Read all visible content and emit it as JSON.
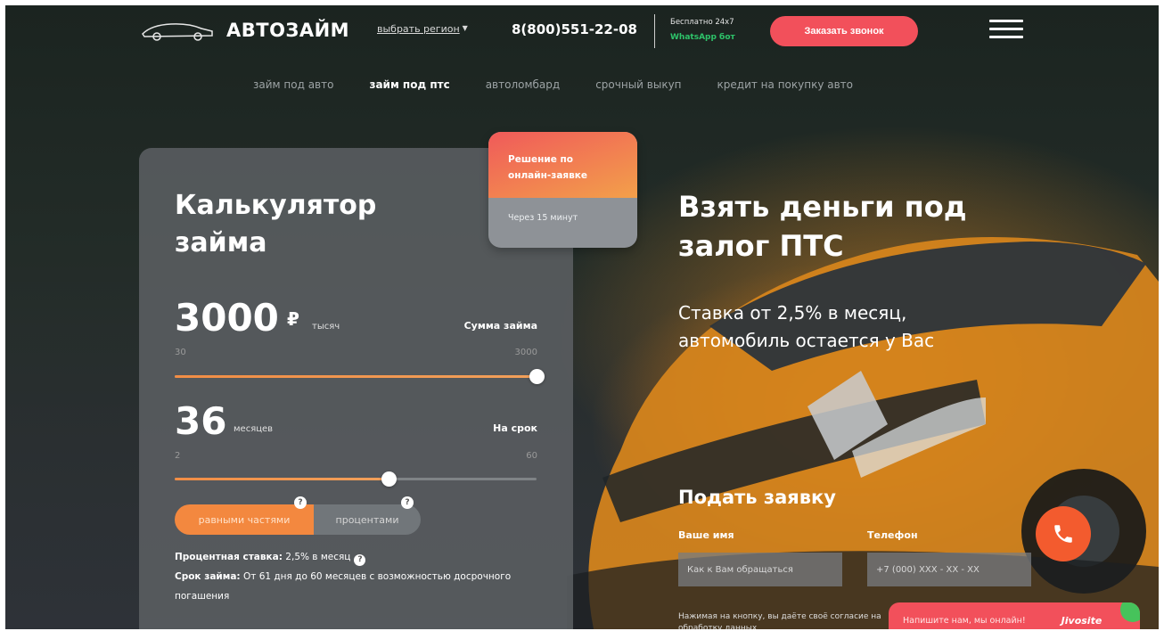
{
  "header": {
    "logo_text": "АВТОЗАЙМ",
    "region_link": "выбрать регион",
    "phone": "8(800)551-22-08",
    "free_text": "Бесплатно 24x7",
    "whatsapp_text": "WhatsApp бот",
    "call_button": "Заказать звонок"
  },
  "nav": [
    {
      "label": "займ под авто",
      "active": false
    },
    {
      "label": "займ под птс",
      "active": true
    },
    {
      "label": "автоломбард",
      "active": false
    },
    {
      "label": "срочный выкуп",
      "active": false
    },
    {
      "label": "кредит на покупку авто",
      "active": false
    }
  ],
  "calculator": {
    "title": "Калькулятор займа",
    "amount": {
      "value": "3000",
      "currency_symbol": "₽",
      "unit": "тысяч",
      "label": "Сумма займа",
      "min": "30",
      "max": "3000",
      "fraction": 1.0
    },
    "term": {
      "value": "36",
      "unit": "месяцев",
      "label": "На срок",
      "min": "2",
      "max": "60",
      "fraction": 0.59
    },
    "payment_toggle": {
      "option_a": "равными частями",
      "option_b": "процентами",
      "selected": "option_a",
      "help": "?"
    },
    "rate_label": "Процентная ставка:",
    "rate_value": "2,5% в месяц",
    "term_info_label": "Срок займа:",
    "term_info_value": "От 61 дня до 60 месяцев с возможностью досрочного погашения"
  },
  "badge": {
    "title": "Решение по онлайн-заявке",
    "subtitle": "Через 15 минут"
  },
  "hero": {
    "title": "Взять деньги под залог ПТС",
    "subtitle": "Ставка от 2,5% в месяц, автомобиль остается у Вас"
  },
  "application": {
    "title": "Подать заявку",
    "name_label": "Ваше имя",
    "name_placeholder": "Как к Вам обращаться",
    "phone_label": "Телефон",
    "phone_placeholder": "+7 (000) XXX - XX - XX",
    "notice": "Нажимая на кнопку, вы даёте своё согласие на обработку данных"
  },
  "chat_widget": {
    "text": "Напишите нам, мы онлайн!",
    "brand": "Jivosite"
  },
  "colors": {
    "accent_red": "#f2505b",
    "accent_orange": "#f3883f",
    "whatsapp_green": "#2ec36a",
    "fab_orange": "#f35b2e"
  }
}
